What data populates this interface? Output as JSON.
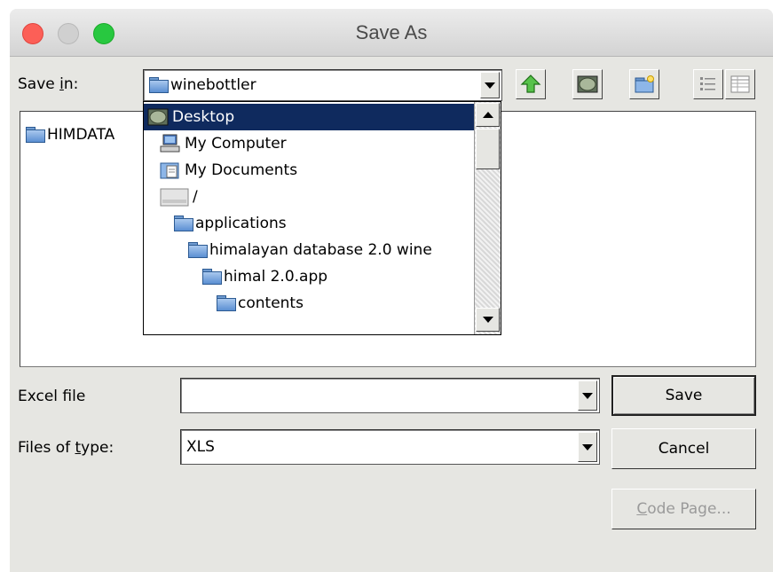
{
  "window": {
    "title": "Save As"
  },
  "save_in": {
    "label_pre": "Save ",
    "label_u": "i",
    "label_post": "n:",
    "value": "winebottler"
  },
  "file_list": [
    {
      "name": "HIMDATA"
    }
  ],
  "dropdown_items": [
    {
      "label": "Desktop",
      "icon": "desktop-icon",
      "selected": true
    },
    {
      "label": "My Computer",
      "icon": "computer-icon"
    },
    {
      "label": "My Documents",
      "icon": "documents-icon"
    },
    {
      "label": "/",
      "icon": "drive-icon"
    },
    {
      "label": "applications",
      "icon": "folder-icon"
    },
    {
      "label": "himalayan database 2.0 wine",
      "icon": "folder-icon"
    },
    {
      "label": "himal 2.0.app",
      "icon": "folder-icon"
    },
    {
      "label": "contents",
      "icon": "folder-icon"
    }
  ],
  "excel_file": {
    "label": "Excel file",
    "value": ""
  },
  "files_of_type": {
    "label_pre": "Files of ",
    "label_u": "t",
    "label_post": "ype:",
    "value": "XLS"
  },
  "buttons": {
    "save": "Save",
    "cancel": "Cancel",
    "code_page_u": "C",
    "code_page_rest": "ode Page..."
  }
}
